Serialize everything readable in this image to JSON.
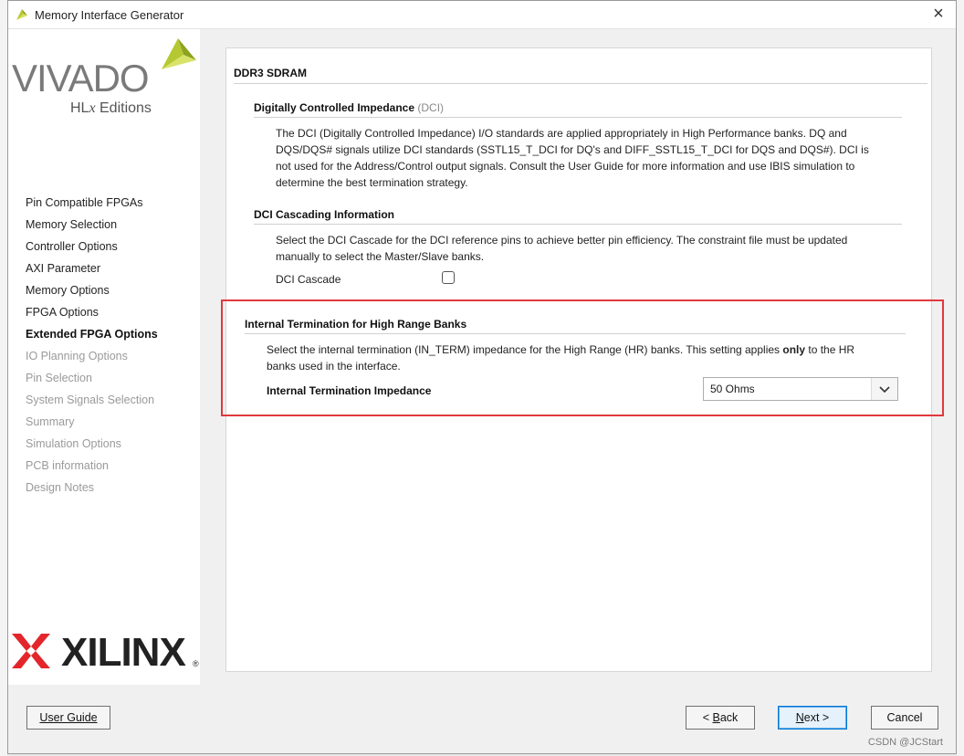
{
  "window": {
    "title": "Memory Interface Generator",
    "close_glyph": "×",
    "icon": "vivado-leaf-icon"
  },
  "sidebar": {
    "logo_text": "VIVADO",
    "logo_sub_prefix": "HL",
    "logo_sub_x": "x",
    "logo_sub_suffix": " Editions",
    "nav_items": [
      {
        "label": "Pin Compatible FPGAs",
        "state": "done"
      },
      {
        "label": "Memory Selection",
        "state": "done"
      },
      {
        "label": "Controller Options",
        "state": "done"
      },
      {
        "label": "AXI Parameter",
        "state": "done"
      },
      {
        "label": "Memory Options",
        "state": "done"
      },
      {
        "label": "FPGA Options",
        "state": "done"
      },
      {
        "label": "Extended FPGA Options",
        "state": "current"
      },
      {
        "label": "IO Planning Options",
        "state": "pending"
      },
      {
        "label": "Pin Selection",
        "state": "pending"
      },
      {
        "label": "System Signals Selection",
        "state": "pending"
      },
      {
        "label": "Summary",
        "state": "pending"
      },
      {
        "label": "Simulation Options",
        "state": "pending"
      },
      {
        "label": "PCB information",
        "state": "pending"
      },
      {
        "label": "Design Notes",
        "state": "pending"
      }
    ],
    "brand_text": "XILINX",
    "brand_reg": "®"
  },
  "main": {
    "header": "DDR3 SDRAM",
    "dci": {
      "title": "Digitally Controlled Impedance ",
      "title_suffix": "(DCI)",
      "line1": "The DCI (Digitally Controlled Impedance) I/O standards are applied appropriately in High Performance banks. DQ and",
      "line2": "DQS/DQS# signals utilize DCI standards (SSTL15_T_DCI for DQ's and DIFF_SSTL15_T_DCI for DQS and DQS#). DCI is",
      "line3": "not used for the Address/Control output signals. Consult the User Guide for more information and use IBIS simulation to",
      "line4": "determine the best termination strategy."
    },
    "cascade": {
      "title": "DCI Cascading Information",
      "line1": "Select the DCI Cascade for the DCI reference pins to achieve better pin efficiency. The constraint file must be updated",
      "line2": "manually to select the Master/Slave banks.",
      "checkbox_label": "DCI Cascade",
      "checked": false
    },
    "internal_term": {
      "title": "Internal Termination for High Range Banks",
      "line1_pre": "Select the internal termination (IN_TERM) impedance for the High Range (HR) banks. This setting applies ",
      "line1_bold": "only",
      "line1_post": " to the HR",
      "line2": "banks used in the interface.",
      "field_label": "Internal Termination Impedance",
      "selected_value": "50 Ohms"
    }
  },
  "footer": {
    "user_guide": "User Guide",
    "back_pre": "< ",
    "back_u": "B",
    "back_post": "ack",
    "next_u": "N",
    "next_post": "ext >",
    "cancel": "Cancel"
  },
  "watermark": "CSDN @JCStart",
  "colors": {
    "highlight_border": "#e0393e",
    "primary_button_border": "#0078d7",
    "vivado_leaf": "#b5c832"
  }
}
